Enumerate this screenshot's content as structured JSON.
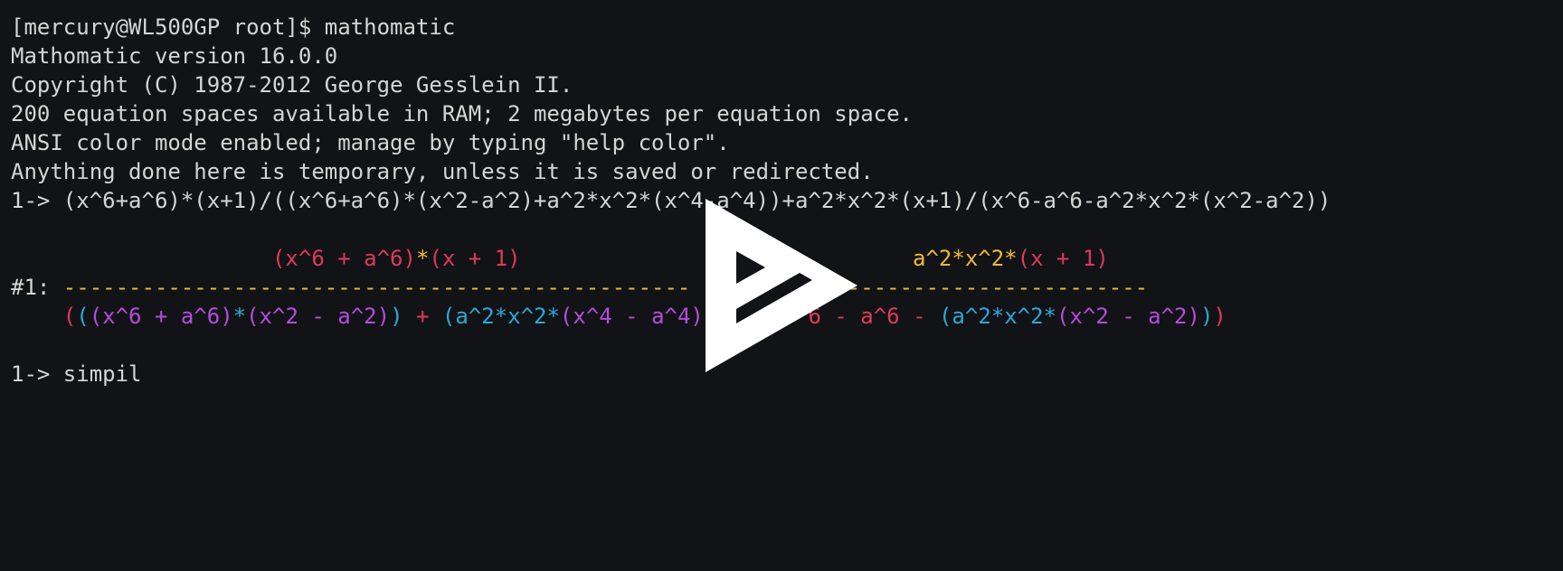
{
  "terminal": {
    "colors": {
      "background": "#121316",
      "text": "#d5d5d5",
      "red": "#e0395a",
      "yellow": "#f0b93a",
      "magenta": "#b64bdc",
      "cyan": "#2fa7d9"
    },
    "lines": [
      [
        {
          "t": "[mercury@WL500GP root]$ mathomatic",
          "c": "text"
        }
      ],
      [
        {
          "t": "Mathomatic version 16.0.0",
          "c": "text"
        }
      ],
      [
        {
          "t": "Copyright (C) 1987-2012 George Gesslein II.",
          "c": "text"
        }
      ],
      [
        {
          "t": "200 equation spaces available in RAM; 2 megabytes per equation space.",
          "c": "text"
        }
      ],
      [
        {
          "t": "ANSI color mode enabled; manage by typing \"help color\".",
          "c": "text"
        }
      ],
      [
        {
          "t": "Anything done here is temporary, unless it is saved or redirected.",
          "c": "text"
        }
      ],
      [
        {
          "t": "1-> (x^6+a^6)*(x+1)/((x^6+a^6)*(x^2-a^2)+a^2*x^2*(x^4-a^4))+a^2*x^2*(x+1)/(x^6-a^6-a^2*x^2*(x^2-a^2))",
          "c": "text"
        }
      ],
      [
        {
          "t": "",
          "c": "text"
        }
      ],
      [
        {
          "t": "                    ",
          "c": "text"
        },
        {
          "t": "(x^6 + a^6)",
          "c": "red"
        },
        {
          "t": "*",
          "c": "yellow"
        },
        {
          "t": "(x + 1)",
          "c": "red"
        },
        {
          "t": "                              ",
          "c": "text"
        },
        {
          "t": "a^2*x^2*",
          "c": "yellow"
        },
        {
          "t": "(x + 1)",
          "c": "red"
        }
      ],
      [
        {
          "t": "#1: ",
          "c": "text"
        },
        {
          "t": "------------------------------------------------",
          "c": "yellow"
        },
        {
          "t": "     ",
          "c": "text"
        },
        {
          "t": "------------------------------",
          "c": "yellow"
        }
      ],
      [
        {
          "t": "    ",
          "c": "text"
        },
        {
          "t": "(",
          "c": "red"
        },
        {
          "t": "(",
          "c": "cyan"
        },
        {
          "t": "(x^6 + a^6)",
          "c": "magenta"
        },
        {
          "t": "*",
          "c": "cyan"
        },
        {
          "t": "(x^2 - a^2)",
          "c": "magenta"
        },
        {
          "t": ")",
          "c": "cyan"
        },
        {
          "t": " + ",
          "c": "red"
        },
        {
          "t": "(",
          "c": "cyan"
        },
        {
          "t": "a^2*x^2*",
          "c": "cyan"
        },
        {
          "t": "(x^4 - a^4)",
          "c": "magenta"
        },
        {
          "t": "        ",
          "c": "text"
        },
        {
          "t": "6 - a^6 - ",
          "c": "red"
        },
        {
          "t": "(",
          "c": "cyan"
        },
        {
          "t": "a^2*x^2*",
          "c": "cyan"
        },
        {
          "t": "(x^2 - a^2)",
          "c": "magenta"
        },
        {
          "t": ")",
          "c": "cyan"
        },
        {
          "t": ")",
          "c": "red"
        }
      ],
      [
        {
          "t": "",
          "c": "text"
        }
      ],
      [
        {
          "t": "1-> simpil",
          "c": "text"
        }
      ]
    ]
  },
  "overlay": {
    "icon": "play-icon",
    "color": "#ffffff"
  }
}
